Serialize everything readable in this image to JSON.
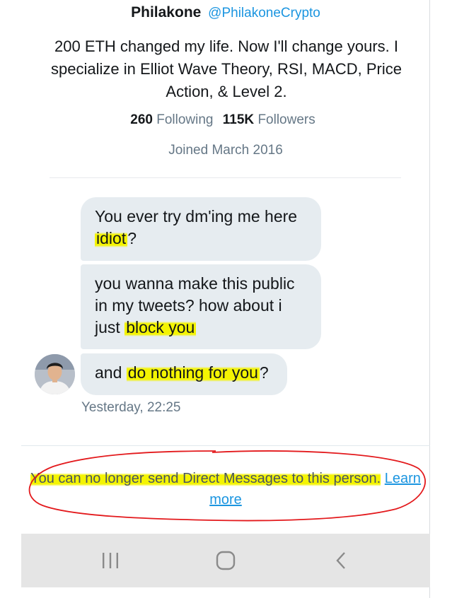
{
  "profile": {
    "name": "Philakone",
    "handle": "@PhilakoneCrypto",
    "bio": "200 ETH changed my life. Now I'll change yours. I specialize in Elliot Wave Theory, RSI, MACD, Price Action, & Level 2.",
    "following_count": "260",
    "following_label": "Following",
    "followers_count": "115K",
    "followers_label": "Followers",
    "joined": "Joined March 2016"
  },
  "messages": [
    {
      "pre": "You ever try dm'ing me here ",
      "highlight": "idiot",
      "post": "?"
    },
    {
      "pre": "you wanna make this public in my tweets? how about i just ",
      "highlight": "block you",
      "post": ""
    },
    {
      "pre": "and ",
      "highlight": "do nothing for you",
      "post": "?"
    }
  ],
  "timestamp": "Yesterday, 22:25",
  "notice": {
    "text": "You can no longer send Direct Messages to this person.",
    "link": "Learn more"
  },
  "colors": {
    "accent": "#1b95e0",
    "bubble": "#e6ecf0",
    "highlight": "#f4f402",
    "annotation_ring": "#e3191c"
  },
  "nav": {
    "icons": [
      "recent-apps-icon",
      "home-icon",
      "back-icon"
    ]
  }
}
